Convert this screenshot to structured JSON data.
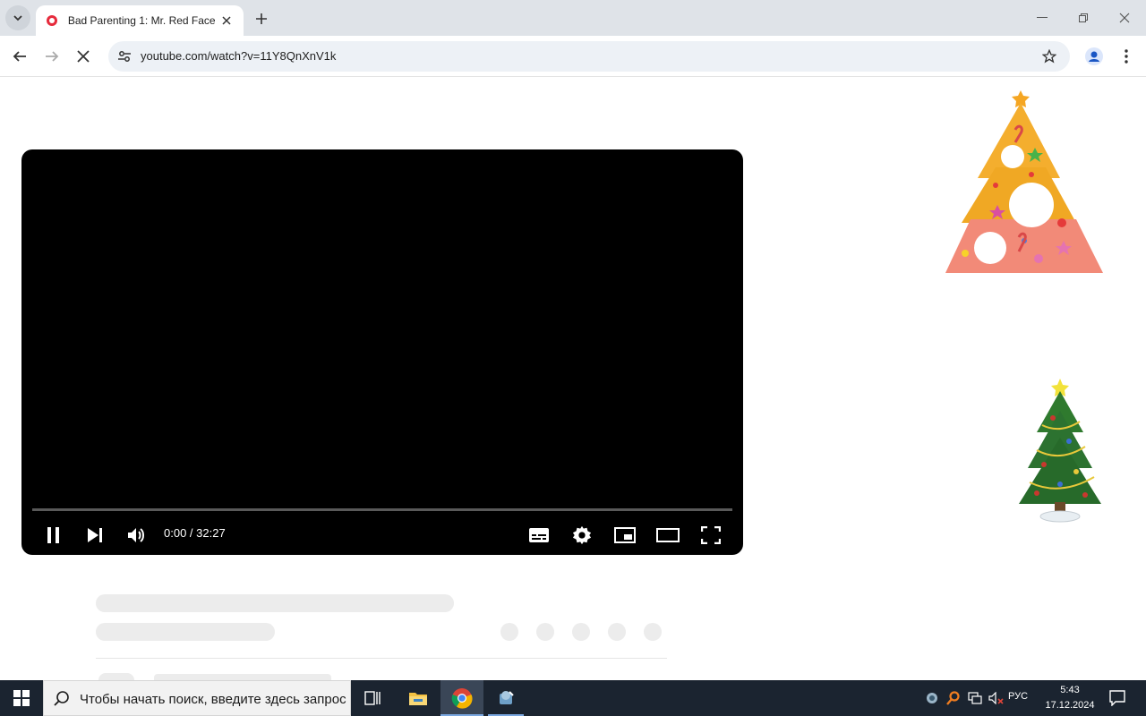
{
  "browser": {
    "tab_title": "Bad Parenting 1: Mr. Red Face |",
    "url": "youtube.com/watch?v=11Y8QnXnV1k"
  },
  "player": {
    "time": "0:00 / 32:27",
    "progress": 0.0
  },
  "taskbar": {
    "search_placeholder": "Чтобы начать поиск, введите здесь запрос",
    "language": "РУС",
    "time": "5:43",
    "date": "17.12.2024"
  },
  "colors": {
    "tab_strip": "#dfe3e8",
    "omnibox": "#edf1f6",
    "player_bg": "#000000",
    "skeleton": "#ececec",
    "taskbar": "#1b2430"
  },
  "icons": [
    "tab-search-icon",
    "youtube-favicon-icon",
    "close-tab-icon",
    "new-tab-icon",
    "minimize-icon",
    "maximize-icon",
    "close-window-icon",
    "back-icon",
    "forward-icon",
    "stop-loading-icon",
    "site-settings-icon",
    "bookmark-star-icon",
    "profile-icon",
    "menu-icon",
    "pause-icon",
    "next-icon",
    "volume-icon",
    "subtitles-icon",
    "settings-icon",
    "miniplayer-icon",
    "theater-icon",
    "fullscreen-icon",
    "windows-start-icon",
    "search-icon",
    "task-view-icon",
    "file-explorer-icon",
    "chrome-icon",
    "app-icon",
    "christmas-tree-decoration-icon"
  ]
}
